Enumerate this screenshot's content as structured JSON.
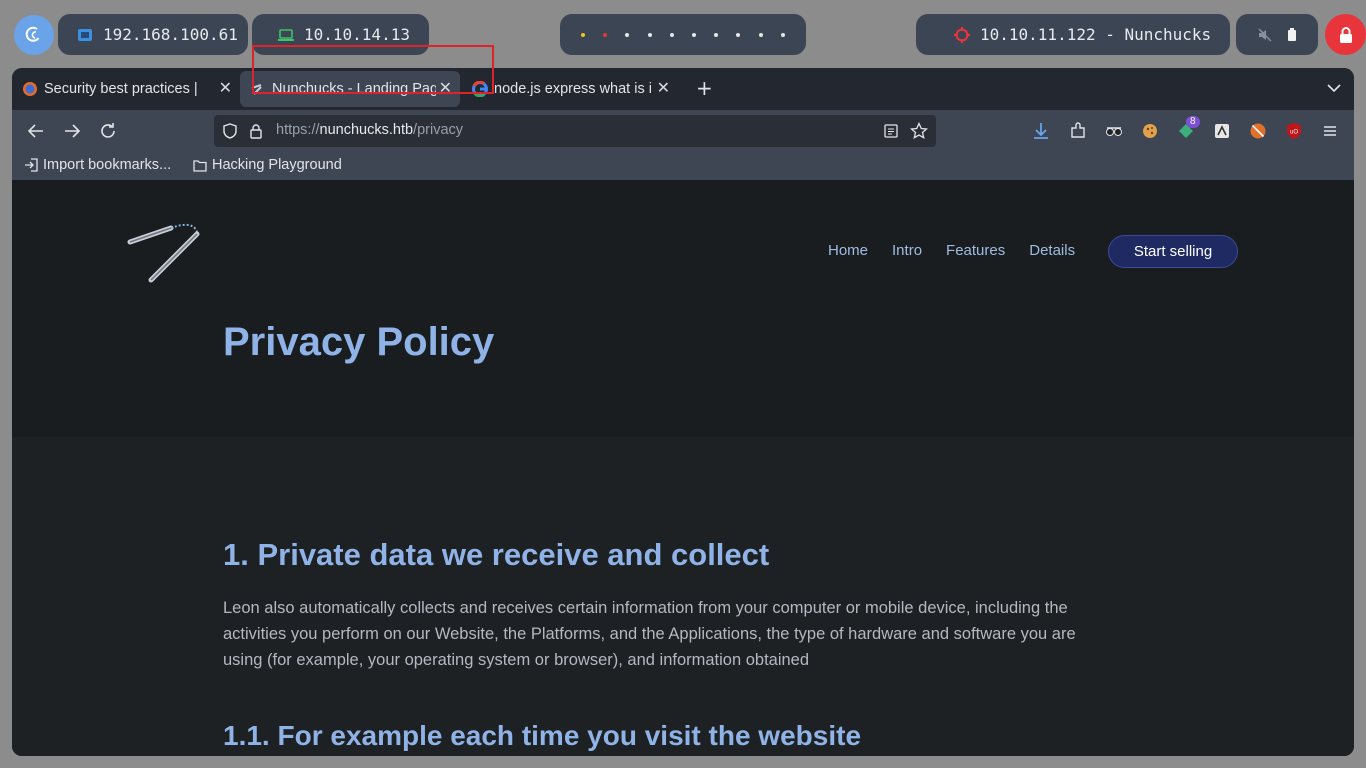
{
  "system_bar": {
    "ip_local": "192.168.100.61",
    "ip_vpn": "10.10.14.13",
    "target": "10.10.11.122 - Nunchucks",
    "workspace_count": 10
  },
  "browser": {
    "tabs": [
      {
        "title": "Security best practices | "
      },
      {
        "title": "Nunchucks - Landing Pag"
      },
      {
        "title": "node.js express what is i"
      }
    ],
    "url": {
      "scheme": "https://",
      "host": "nunchucks.htb",
      "path": "/privacy"
    },
    "extensions_badge": "8",
    "bookmarks": [
      {
        "label": "Import bookmarks..."
      },
      {
        "label": "Hacking Playground"
      }
    ]
  },
  "site": {
    "nav": [
      "Home",
      "Intro",
      "Features",
      "Details"
    ],
    "cta": "Start selling",
    "page_title": "Privacy Policy",
    "section_heading": "1. Private data we receive and collect",
    "section_text": "Leon also automatically collects and receives certain information from your computer or mobile device, including the activities you perform on our Website, the Platforms, and the Applications, the type of hardware and software you are using (for example, your operating system or browser), and information obtained",
    "subsection_heading": "1.1. For example each time you visit the website"
  },
  "colors": {
    "accent": "#8fb3e6",
    "cta_background": "#1f2a63",
    "highlight_box": "#e0232b",
    "lock_button": "#e8343b"
  }
}
